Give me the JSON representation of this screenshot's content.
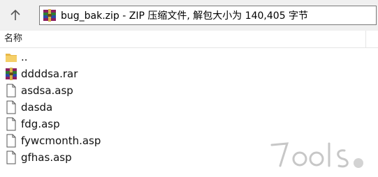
{
  "nav": {
    "path_text": "bug_bak.zip - ZIP 压缩文件, 解包大小为 140,405 字节"
  },
  "columns": {
    "name_header": "名称"
  },
  "files": [
    {
      "name": "..",
      "icon": "folder-up-icon"
    },
    {
      "name": "ddddsa.rar",
      "icon": "rar-archive-icon"
    },
    {
      "name": "asdsa.asp",
      "icon": "file-icon"
    },
    {
      "name": "dasda",
      "icon": "file-icon"
    },
    {
      "name": "fdg.asp",
      "icon": "file-icon"
    },
    {
      "name": "fywcmonth.asp",
      "icon": "file-icon"
    },
    {
      "name": "gfhas.asp",
      "icon": "file-icon"
    }
  ],
  "watermark": {
    "text": "7ools"
  }
}
